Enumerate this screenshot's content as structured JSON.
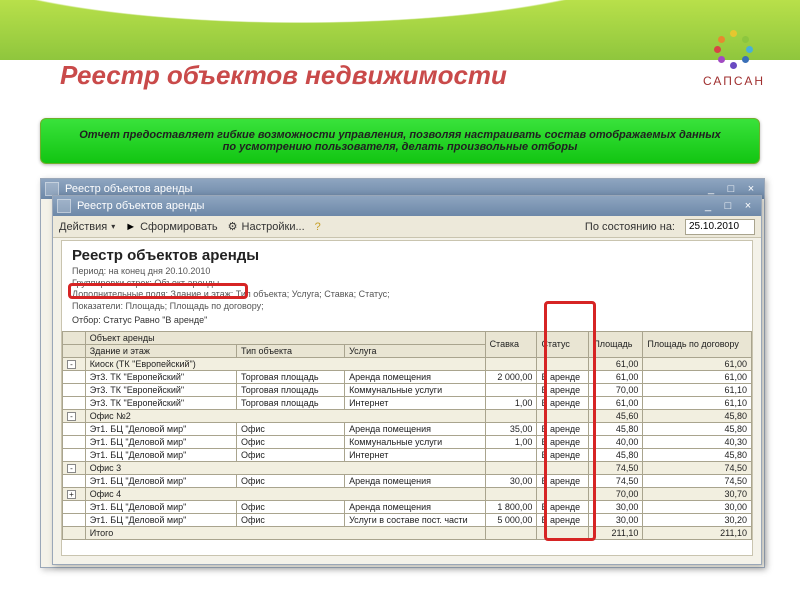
{
  "slide": {
    "title": "Реестр объектов недвижимости",
    "logo_text": "САПСАН"
  },
  "banner": "Отчет предоставляет гибкие возможности управления, позволяя настраивать состав отображаемых данных по усмотрению пользователя, делать произвольные отборы",
  "win1": {
    "title": "Реестр объектов аренды"
  },
  "win2": {
    "title": "Реестр объектов аренды",
    "toolbar": {
      "actions": "Действия",
      "form": "Сформировать",
      "settings": "Настройки...",
      "date_label": "По состоянию на:",
      "date_value": "25.10.2010"
    }
  },
  "report": {
    "title": "Реестр объектов аренды",
    "period": "Период: на конец дня 20.10.2010",
    "group": "Группировки строк: Объект аренды",
    "extra": "Дополнительные поля: Здание и этаж; Тип объекта; Услуга; Ставка; Статус;",
    "indicators": "Показатели: Площадь; Площадь по договору;",
    "filter": "Отбор: Статус Равно \"В аренде\"",
    "headers": {
      "obj": "Объект аренды",
      "building": "Здание и этаж",
      "type": "Тип объекта",
      "service": "Услуга",
      "rate": "Ставка",
      "status": "Статус",
      "area": "Площадь",
      "area_c": "Площадь по договору"
    },
    "rows": [
      {
        "g": 1,
        "t": "-",
        "obj": "Киоск (ТК \"Европейский\")",
        "a": "61,00",
        "c": "61,00"
      },
      {
        "obj": "Эт3. ТК \"Европейский\"",
        "type": "Торговая площадь",
        "svc": "Аренда помещения",
        "rate": "2 000,00",
        "st": "В аренде",
        "a": "61,00",
        "c": "61,00"
      },
      {
        "obj": "Эт3. ТК \"Европейский\"",
        "type": "Торговая площадь",
        "svc": "Коммунальные услуги",
        "rate": "",
        "st": "В аренде",
        "a": "70,00",
        "c": "61,10"
      },
      {
        "obj": "Эт3. ТК \"Европейский\"",
        "type": "Торговая площадь",
        "svc": "Интернет",
        "rate": "1,00",
        "st": "В аренде",
        "a": "61,00",
        "c": "61,10"
      },
      {
        "g": 1,
        "t": "-",
        "obj": "Офис №2",
        "a": "45,60",
        "c": "45,80"
      },
      {
        "obj": "Эт1. БЦ \"Деловой мир\"",
        "type": "Офис",
        "svc": "Аренда помещения",
        "rate": "35,00",
        "st": "В аренде",
        "a": "45,80",
        "c": "45,80"
      },
      {
        "obj": "Эт1. БЦ \"Деловой мир\"",
        "type": "Офис",
        "svc": "Коммунальные услуги",
        "rate": "1,00",
        "st": "В аренде",
        "a": "40,00",
        "c": "40,30"
      },
      {
        "obj": "Эт1. БЦ \"Деловой мир\"",
        "type": "Офис",
        "svc": "Интернет",
        "rate": "",
        "st": "В аренде",
        "a": "45,80",
        "c": "45,80"
      },
      {
        "g": 1,
        "t": "-",
        "obj": "Офис 3",
        "a": "74,50",
        "c": "74,50"
      },
      {
        "obj": "Эт1. БЦ \"Деловой мир\"",
        "type": "Офис",
        "svc": "Аренда помещения",
        "rate": "30,00",
        "st": "В аренде",
        "a": "74,50",
        "c": "74,50"
      },
      {
        "g": 1,
        "t": "+",
        "obj": "Офис 4",
        "a": "70,00",
        "c": "30,70"
      },
      {
        "obj": "Эт1. БЦ \"Деловой мир\"",
        "type": "Офис",
        "svc": "Аренда помещения",
        "rate": "1 800,00",
        "st": "В аренде",
        "a": "30,00",
        "c": "30,00"
      },
      {
        "obj": "Эт1. БЦ \"Деловой мир\"",
        "type": "Офис",
        "svc": "Услуги в составе пост. части",
        "rate": "5 000,00",
        "st": "В аренде",
        "a": "30,00",
        "c": "30,20"
      },
      {
        "g": 2,
        "obj": "Итого",
        "a": "211,10",
        "c": "211,10"
      }
    ]
  }
}
